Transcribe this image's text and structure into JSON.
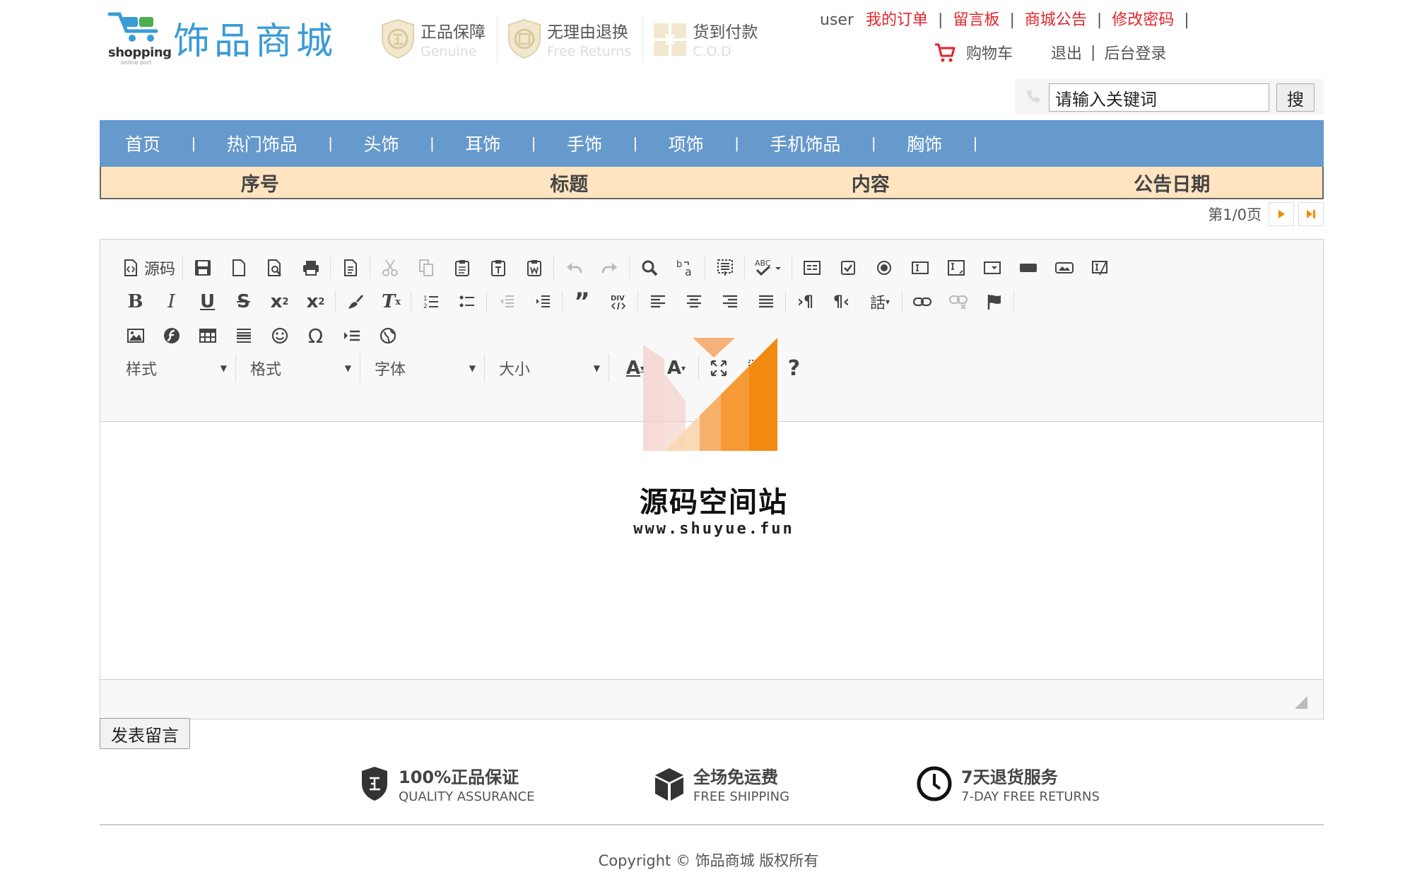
{
  "header": {
    "logo_text": "shopping",
    "logo_sub": "online port",
    "site_name": "饰品商城",
    "badges": [
      {
        "title": "正品保障",
        "subtitle": "Genuine",
        "icon": "shield-check-icon"
      },
      {
        "title": "无理由退换",
        "subtitle": "Free Returns",
        "icon": "return-shield-icon"
      },
      {
        "title": "货到付款",
        "subtitle": "C.O.D",
        "icon": "gift-box-icon"
      }
    ],
    "toplinks": {
      "user": "user",
      "my_orders": "我的订单",
      "message_board": "留言板",
      "announcements": "商城公告",
      "change_password": "修改密码"
    },
    "sublinks": {
      "cart": "购物车",
      "logout": "退出",
      "admin_login": "后台登录"
    }
  },
  "search": {
    "value": "请输入关键词",
    "button": "搜"
  },
  "nav": {
    "items": [
      "首页",
      "热门饰品",
      "头饰",
      "耳饰",
      "手饰",
      "项饰",
      "手机饰品",
      "胸饰"
    ],
    "separator": "|"
  },
  "table": {
    "columns": [
      "序号",
      "标题",
      "内容",
      "公告日期"
    ]
  },
  "pager": {
    "text": "第1/0页"
  },
  "editor": {
    "source_label": "源码",
    "combos": [
      "样式",
      "格式",
      "字体",
      "大小"
    ],
    "help": "?"
  },
  "watermark": {
    "title": "源码空间站",
    "url": "www.shuyue.fun"
  },
  "submit": {
    "label": "发表留言"
  },
  "features": [
    {
      "title": "100%正品保证",
      "subtitle": "QUALITY ASSURANCE",
      "icon": "shield-icon"
    },
    {
      "title": "全场免运费",
      "subtitle": "FREE SHIPPING",
      "icon": "box-icon"
    },
    {
      "title": "7天退货服务",
      "subtitle": "7-DAY FREE RETURNS",
      "icon": "clock-icon"
    }
  ],
  "footer": {
    "copyright": "Copyright © 饰品商城 版权所有"
  },
  "colors": {
    "nav_bg": "#6699cc",
    "table_head_bg": "#ffe4c0",
    "link_red": "#e3242b",
    "brand_blue": "#3a9bd6"
  }
}
